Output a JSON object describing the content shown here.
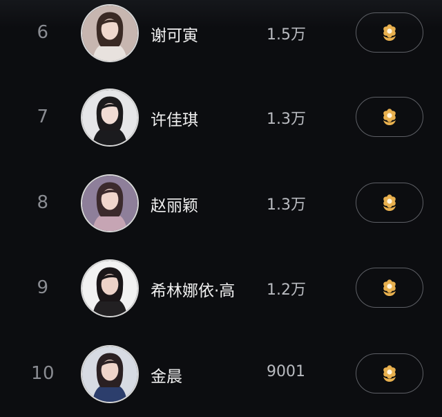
{
  "ranking": [
    {
      "rank": "6",
      "name": "谢可寅",
      "count": "1.5万",
      "bg": "#c7b6b0",
      "hair": "#3a2a24",
      "skin": "#efd8cd",
      "cloth": "#e8e2de"
    },
    {
      "rank": "7",
      "name": "许佳琪",
      "count": "1.3万",
      "bg": "#e6e6e8",
      "hair": "#1c1a1c",
      "skin": "#f1dcd4",
      "cloth": "#1b1b1e"
    },
    {
      "rank": "8",
      "name": "赵丽颖",
      "count": "1.3万",
      "bg": "#8e7f9a",
      "hair": "#3b2a2c",
      "skin": "#f0d6cd",
      "cloth": "#c6a5b4"
    },
    {
      "rank": "9",
      "name": "希林娜依·高",
      "count": "1.2万",
      "bg": "#f2f2f2",
      "hair": "#1a1618",
      "skin": "#ecd2c8",
      "cloth": "#222022"
    },
    {
      "rank": "10",
      "name": "金晨",
      "count": "9001",
      "bg": "#d7dbe3",
      "hair": "#2a2022",
      "skin": "#efd5ca",
      "cloth": "#2c3e6c"
    }
  ],
  "button_icon": "flower-icon",
  "colors": {
    "background": "#0c0d10",
    "flower_petal": "#e8b04e",
    "flower_center": "#fff4dc",
    "button_border": "#5e6066"
  }
}
